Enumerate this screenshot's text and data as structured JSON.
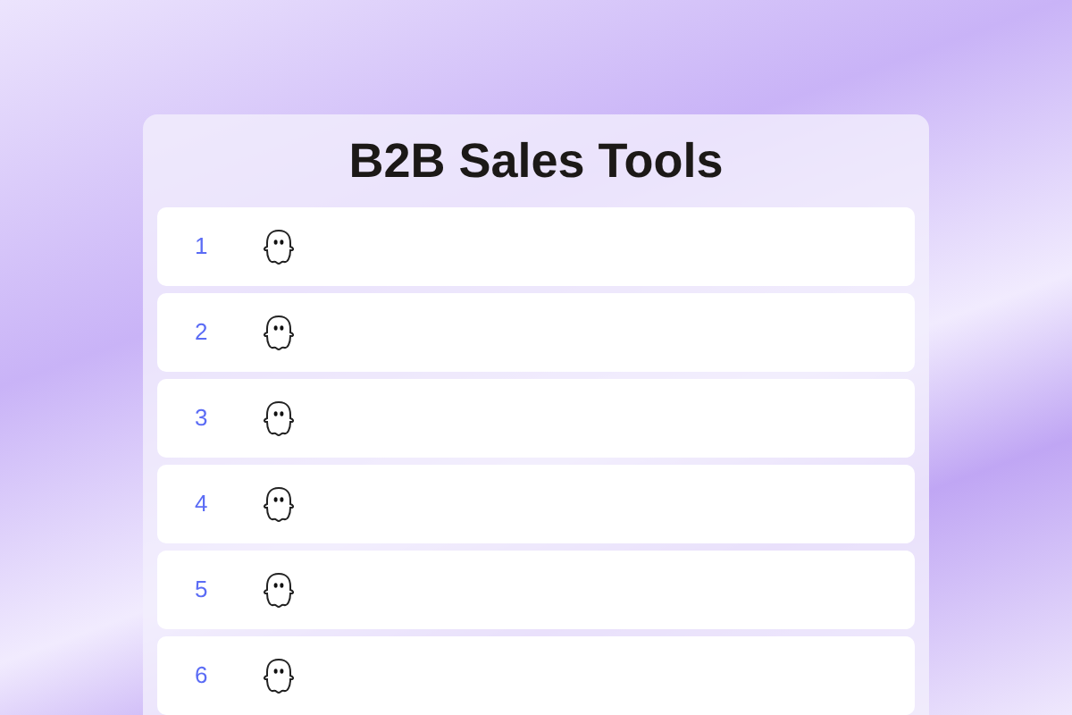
{
  "title": "B2B Sales Tools",
  "rows": [
    {
      "number": "1"
    },
    {
      "number": "2"
    },
    {
      "number": "3"
    },
    {
      "number": "4"
    },
    {
      "number": "5"
    },
    {
      "number": "6"
    }
  ]
}
